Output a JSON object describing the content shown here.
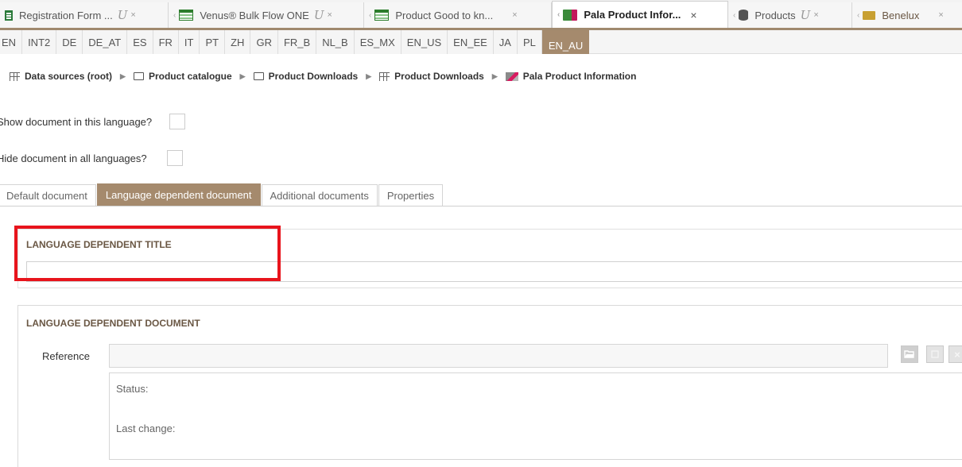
{
  "editor_tabs": [
    {
      "label": "Registration Form ...",
      "icon": "document-icon",
      "pinned": true,
      "active": false
    },
    {
      "label": "Venus® Bulk Flow ONE",
      "icon": "grid-icon",
      "pinned": true,
      "active": false
    },
    {
      "label": "Product Good to kn...",
      "icon": "grid-icon",
      "pinned": false,
      "active": false
    },
    {
      "label": "Pala Product Infor...",
      "icon": "pala-icon",
      "pinned": false,
      "active": true
    },
    {
      "label": "Products",
      "icon": "database-icon",
      "pinned": true,
      "active": false
    },
    {
      "label": "Benelux",
      "icon": "folder-icon",
      "pinned": false,
      "active": false
    }
  ],
  "tab_close": "×",
  "tab_pin": "U",
  "tab_lead": "‹",
  "languages": [
    "EN",
    "INT2",
    "DE",
    "DE_AT",
    "ES",
    "FR",
    "IT",
    "PT",
    "ZH",
    "GR",
    "FR_B",
    "NL_B",
    "ES_MX",
    "EN_US",
    "EN_EE",
    "JA",
    "PL",
    "EN_AU"
  ],
  "active_language": "EN_AU",
  "breadcrumb": [
    {
      "label": "Data sources (root)",
      "icon": "table-icon"
    },
    {
      "label": "Product catalogue",
      "icon": "folder-icon"
    },
    {
      "label": "Product Downloads",
      "icon": "folder-icon"
    },
    {
      "label": "Product Downloads",
      "icon": "table-icon"
    },
    {
      "label": "Pala Product Information",
      "icon": "pala-icon"
    }
  ],
  "breadcrumb_separator": "▶",
  "options": {
    "show_document": "Show document in this language?",
    "hide_document": "Hide document in all languages?"
  },
  "document_tabs": [
    {
      "label": "Default document",
      "active": false
    },
    {
      "label": "Language dependent document",
      "active": true
    },
    {
      "label": "Additional documents",
      "active": false
    },
    {
      "label": "Properties",
      "active": false
    }
  ],
  "title_panel": {
    "heading": "LANGUAGE DEPENDENT TITLE",
    "value": ""
  },
  "document_panel": {
    "heading": "LANGUAGE DEPENDENT DOCUMENT",
    "reference_label": "Reference",
    "reference_value": "",
    "status_label": "Status:",
    "last_change_label": "Last change:",
    "browse_icon": "folder-open-icon",
    "clear_icon": "clear-icon",
    "remove_icon": "×"
  },
  "colors": {
    "accent": "#a58a6d",
    "heading": "#6a5744",
    "highlight": "#e8141c"
  }
}
